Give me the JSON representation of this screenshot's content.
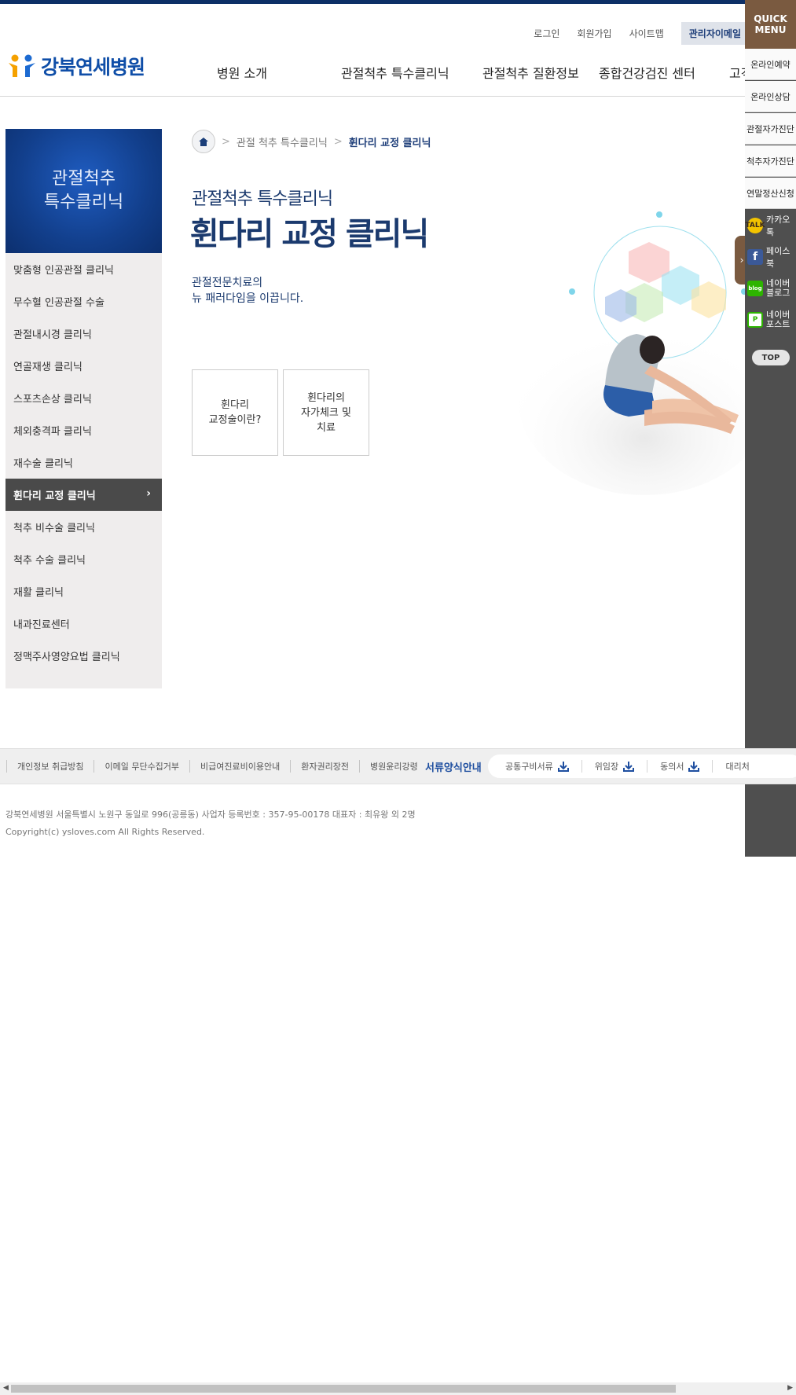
{
  "header": {
    "util_links": [
      "로그인",
      "회원가입",
      "사이트맵"
    ],
    "admin_label": "관리자이메일",
    "logo_text": "강북연세병원",
    "gnb": [
      "병원 소개",
      "관절척추 특수클리닉",
      "관절척추 질환정보",
      "종합건강검진 센터",
      "고객"
    ]
  },
  "sidebar": {
    "title_line1": "관절척추",
    "title_line2": "특수클리닉",
    "items": [
      {
        "label": "맞춤형 인공관절 클리닉"
      },
      {
        "label": "무수혈 인공관절 수술"
      },
      {
        "label": "관절내시경 클리닉"
      },
      {
        "label": "연골재생 클리닉"
      },
      {
        "label": "스포츠손상 클리닉"
      },
      {
        "label": "체외충격파 클리닉"
      },
      {
        "label": "재수술 클리닉"
      },
      {
        "label": "휜다리 교정 클리닉"
      },
      {
        "label": "척추 비수술 클리닉"
      },
      {
        "label": "척추 수술 클리닉"
      },
      {
        "label": "재활 클리닉"
      },
      {
        "label": "내과진료센터"
      },
      {
        "label": "정맥주사영양요법 클리닉"
      }
    ],
    "active_index": 7
  },
  "breadcrumb": {
    "level1": "관절 척추 특수클리닉",
    "current": "휜다리 교정 클리닉"
  },
  "content": {
    "subtitle": "관절척추 특수클리닉",
    "title": "휜다리 교정 클리닉",
    "tagline_line1": "관절전문치료의",
    "tagline_line2": "뉴 패러다임을 이끕니다.",
    "tabs": [
      {
        "line1": "휜다리",
        "line2": "교정술이란?",
        "line3": ""
      },
      {
        "line1": "휜다리의",
        "line2": "자가체크 및",
        "line3": "치료"
      }
    ]
  },
  "quick_menu": {
    "title_line1": "QUICK",
    "title_line2": "MENU",
    "items": [
      "온라인예약",
      "온라인상담",
      "관절자가진단",
      "척추자가진단",
      "연말정산신청"
    ],
    "sns": [
      {
        "label": "카카오톡",
        "line2": "",
        "icon": "kakaotalk-icon",
        "icon_text": "TALK",
        "color": "#f3c400"
      },
      {
        "label": "페이스북",
        "line2": "",
        "icon": "facebook-icon",
        "icon_text": "f",
        "color": "#3b5998"
      },
      {
        "label": "네이버",
        "line2": "블로그",
        "icon": "naver-blog-icon",
        "icon_text": "blog",
        "color": "#2db400"
      },
      {
        "label": "네이버",
        "line2": "포스트",
        "icon": "naver-post-icon",
        "icon_text": "P",
        "color": "#2db400"
      }
    ],
    "top_label": "TOP"
  },
  "footer": {
    "links": [
      "개인정보 취급방침",
      "이메일 무단수집거부",
      "비급여진료비이용안내",
      "환자권리장전",
      "병원윤리강령"
    ],
    "forms_title": "서류양식안내",
    "forms": [
      "공통구비서류",
      "위임장",
      "동의서",
      "대리처"
    ],
    "address": "강북연세병원 서울특별시 노원구 동일로 996(공릉동) 사업자 등록번호 : 357-95-00178 대표자 : 최유왕 외 2명",
    "copyright": "Copyright(c) ysloves.com All Rights Reserved."
  }
}
